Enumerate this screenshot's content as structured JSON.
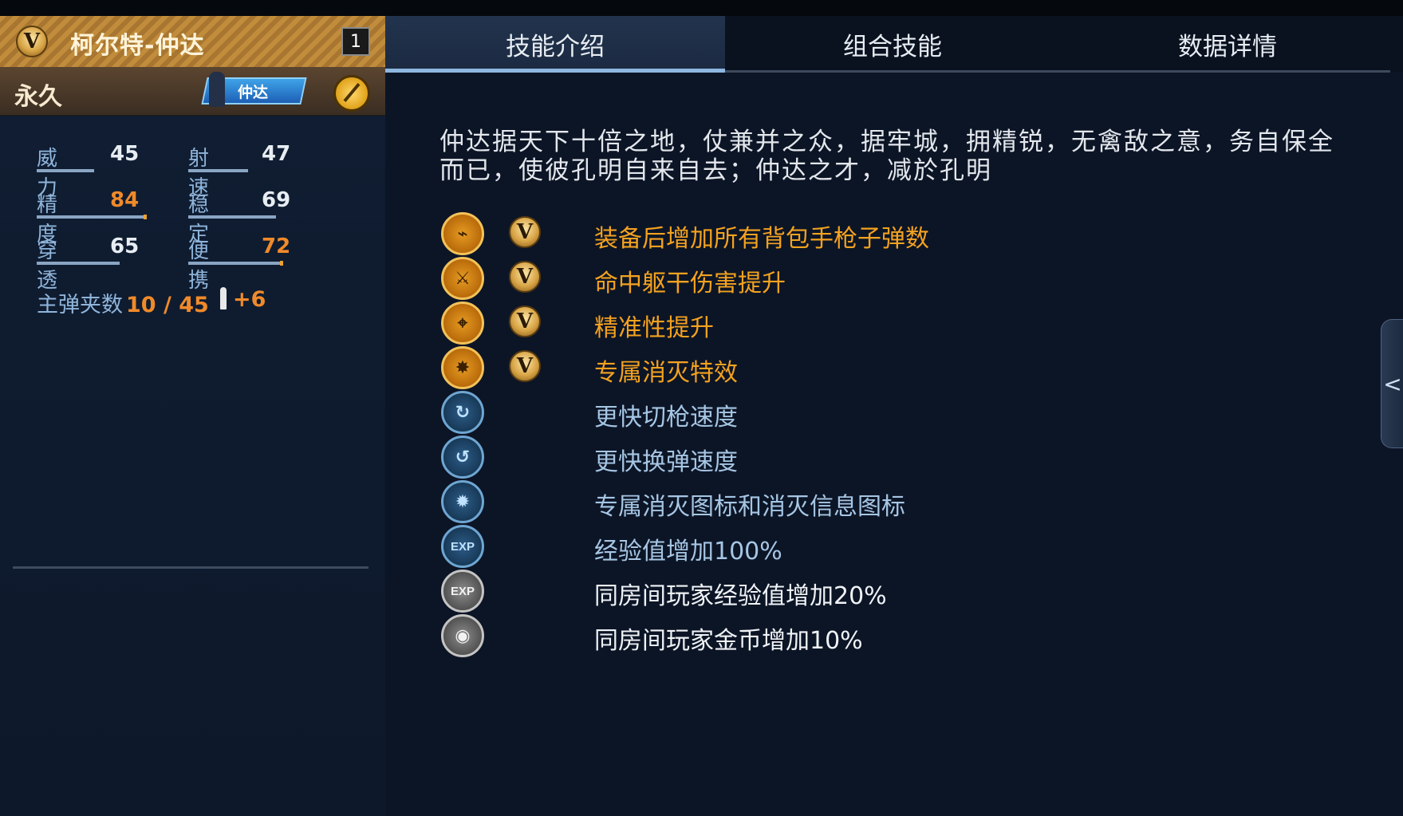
{
  "weapon": {
    "name": "柯尔特-仲达",
    "slot_number": "1",
    "duration": "永久",
    "character_tag": "仲达",
    "rank_badge": "V"
  },
  "stats": [
    {
      "label": "威力",
      "value": "45",
      "highlight": false,
      "level": 0.45
    },
    {
      "label": "射速",
      "value": "47",
      "highlight": false,
      "level": 0.47
    },
    {
      "label": "精度",
      "value": "84",
      "highlight": true,
      "level": 0.84
    },
    {
      "label": "稳定",
      "value": "69",
      "highlight": false,
      "level": 0.69
    },
    {
      "label": "穿透",
      "value": "65",
      "highlight": false,
      "level": 0.65
    },
    {
      "label": "便携",
      "value": "72",
      "highlight": true,
      "level": 0.72
    }
  ],
  "ammo": {
    "label": "主弹夹数",
    "value": "10 / 45",
    "bonus": "+6"
  },
  "tabs": [
    {
      "label": "技能介绍",
      "active": true
    },
    {
      "label": "组合技能",
      "active": false
    },
    {
      "label": "数据详情",
      "active": false
    }
  ],
  "description": "仲达据天下十倍之地，仗兼并之众，据牢城，拥精锐，无禽敌之意，务自保全而已，使彼孔明自来自去；仲达之才，减於孔明",
  "skills": [
    {
      "icon": "pistol-icon",
      "style": "gold",
      "v_badge": true,
      "text": "装备后增加所有背包手枪子弹数",
      "text_style": "gold"
    },
    {
      "icon": "torso-hit-icon",
      "style": "gold",
      "v_badge": true,
      "text": "命中躯干伤害提升",
      "text_style": "gold"
    },
    {
      "icon": "crosshair-icon",
      "style": "gold",
      "v_badge": true,
      "text": "精准性提升",
      "text_style": "gold"
    },
    {
      "icon": "kill-effect-icon",
      "style": "gold",
      "v_badge": true,
      "text": "专属消灭特效",
      "text_style": "gold"
    },
    {
      "icon": "weapon-swap-icon",
      "style": "blue",
      "v_badge": false,
      "text": "更快切枪速度",
      "text_style": "blue"
    },
    {
      "icon": "reload-icon",
      "style": "blue",
      "v_badge": false,
      "text": "更快换弹速度",
      "text_style": "blue"
    },
    {
      "icon": "kill-mark-icon",
      "style": "blue",
      "v_badge": false,
      "text": "专属消灭图标和消灭信息图标",
      "text_style": "blue"
    },
    {
      "icon": "exp-icon",
      "style": "blue",
      "v_badge": false,
      "text": "经验值增加100%",
      "text_style": "blue"
    },
    {
      "icon": "team-exp-icon",
      "style": "grey",
      "v_badge": false,
      "text": "同房间玩家经验值增加20%",
      "text_style": "white"
    },
    {
      "icon": "team-coin-icon",
      "style": "grey",
      "v_badge": false,
      "text": "同房间玩家金币增加10%",
      "text_style": "white"
    }
  ],
  "side_tab_glyph": "<"
}
